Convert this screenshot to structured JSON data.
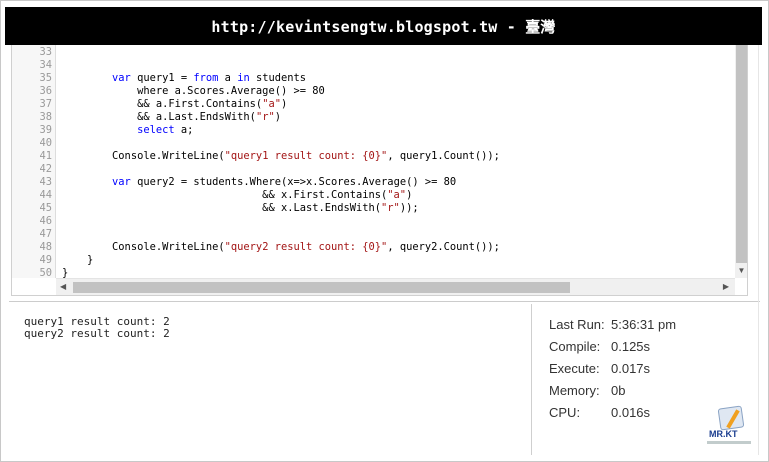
{
  "banner": {
    "title": "http://kevintsengtw.blogspot.tw - 臺灣"
  },
  "editor": {
    "line_numbers": [
      "33",
      "34",
      "35",
      "36",
      "37",
      "38",
      "39",
      "40",
      "41",
      "42",
      "43",
      "44",
      "45",
      "46",
      "47",
      "48",
      "49",
      "50"
    ],
    "lines": [
      {
        "segments": []
      },
      {
        "segments": []
      },
      {
        "segments": [
          [
            "",
            "        "
          ],
          [
            "kw",
            "var"
          ],
          [
            "",
            " query1 = "
          ],
          [
            "kw",
            "from"
          ],
          [
            "",
            " a "
          ],
          [
            "kw",
            "in"
          ],
          [
            "",
            " students"
          ]
        ]
      },
      {
        "segments": [
          [
            "",
            "            where a.Scores.Average() >= 80"
          ]
        ]
      },
      {
        "segments": [
          [
            "",
            "            && a.First.Contains("
          ],
          [
            "str",
            "\"a\""
          ],
          [
            "",
            ")"
          ]
        ]
      },
      {
        "segments": [
          [
            "",
            "            && a.Last.EndsWith("
          ],
          [
            "str",
            "\"r\""
          ],
          [
            "",
            ")"
          ]
        ]
      },
      {
        "segments": [
          [
            "",
            "            "
          ],
          [
            "kw",
            "select"
          ],
          [
            "",
            " a;"
          ]
        ]
      },
      {
        "segments": []
      },
      {
        "segments": [
          [
            "",
            "        Console.WriteLine("
          ],
          [
            "str",
            "\"query1 result count: {0}\""
          ],
          [
            "",
            ", query1.Count());"
          ]
        ]
      },
      {
        "segments": []
      },
      {
        "segments": [
          [
            "",
            "        "
          ],
          [
            "kw",
            "var"
          ],
          [
            "",
            " query2 = students.Where(x=>x.Scores.Average() >= 80"
          ]
        ]
      },
      {
        "segments": [
          [
            "",
            "                                && x.First.Contains("
          ],
          [
            "str",
            "\"a\""
          ],
          [
            "",
            ")"
          ]
        ]
      },
      {
        "segments": [
          [
            "",
            "                                && x.Last.EndsWith("
          ],
          [
            "str",
            "\"r\""
          ],
          [
            "",
            "));"
          ]
        ]
      },
      {
        "segments": []
      },
      {
        "segments": []
      },
      {
        "segments": [
          [
            "",
            "        Console.WriteLine("
          ],
          [
            "str",
            "\"query2 result count: {0}\""
          ],
          [
            "",
            ", query2.Count());"
          ]
        ]
      },
      {
        "segments": [
          [
            "",
            "    }"
          ]
        ]
      },
      {
        "segments": [
          [
            "",
            "}"
          ]
        ]
      }
    ]
  },
  "output": {
    "lines": [
      "query1 result count: 2",
      "query2 result count: 2"
    ]
  },
  "stats": [
    {
      "label": "Last Run:",
      "value": "5:36:31 pm"
    },
    {
      "label": "Compile:",
      "value": "0.125s"
    },
    {
      "label": "Execute:",
      "value": "0.017s"
    },
    {
      "label": "Memory:",
      "value": "0b"
    },
    {
      "label": "CPU:",
      "value": "0.016s"
    }
  ],
  "logo": {
    "text": "MR.KT"
  }
}
